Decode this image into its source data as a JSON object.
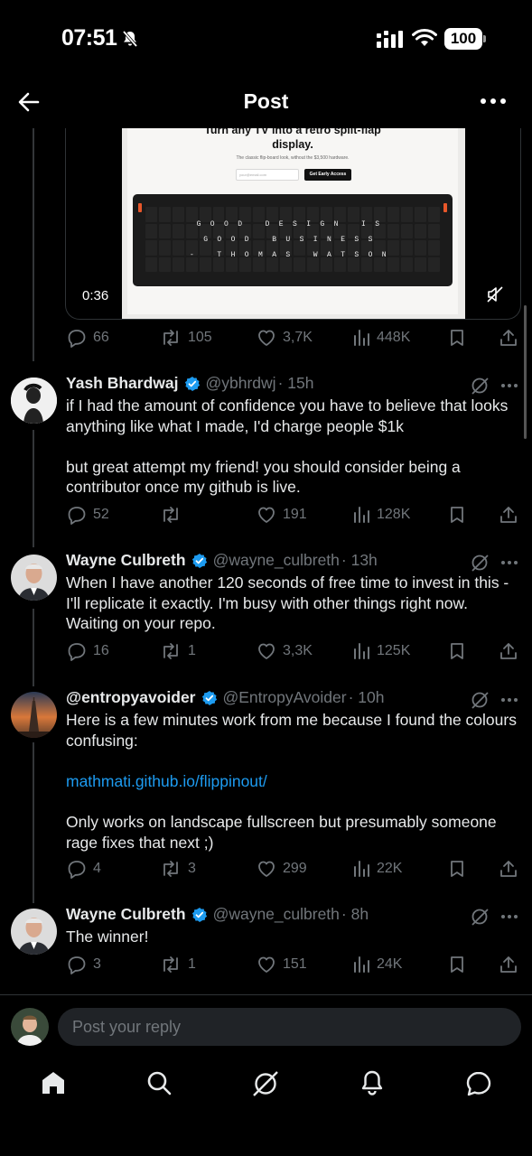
{
  "status_bar": {
    "time": "07:51",
    "battery": "100"
  },
  "header": {
    "title": "Post"
  },
  "video": {
    "headline_line1": "Turn any TV into a retro split-flap",
    "headline_line2": "display.",
    "subtitle": "The classic flip-board look, without the $3,500 hardware.",
    "input_placeholder": "your@email.com",
    "cta": "Get Early Access",
    "board_rows": [
      "GOOD DESIGN IS",
      "GOOD BUSINESS",
      "- THOMAS WATSON"
    ],
    "duration": "0:36"
  },
  "original_post_actions": {
    "replies": "66",
    "reposts": "105",
    "likes": "3,7K",
    "views": "448K"
  },
  "replies": [
    {
      "name": "Yash Bhardwaj",
      "handle": "@ybhrdwj",
      "time": "· 15h",
      "text": "if I had the amount of confidence you have to believe that looks anything like what I made, I'd charge people $1k\n\nbut great attempt my friend! you should consider being a contributor once my github is live.",
      "replies": "52",
      "reposts": "",
      "likes": "191",
      "views": "128K"
    },
    {
      "name": "Wayne Culbreth",
      "handle": "@wayne_culbreth",
      "time": "· 13h",
      "text": "When I have another 120 seconds of free time to invest in this - I'll replicate it exactly. I'm busy with other things right now. Waiting on your repo.",
      "replies": "16",
      "reposts": "1",
      "likes": "3,3K",
      "views": "125K"
    },
    {
      "name": "@entropyavoider",
      "handle": "@EntropyAvoider",
      "time": "· 10h",
      "text_part1": "Here is a few minutes work from me because I found the colours confusing:",
      "link": "mathmati.github.io/flippinout/",
      "text_part2": "Only works on landscape fullscreen but presumably someone rage fixes that next ;)",
      "replies": "4",
      "reposts": "3",
      "likes": "299",
      "views": "22K"
    },
    {
      "name": "Wayne Culbreth",
      "handle": "@wayne_culbreth",
      "time": "· 8h",
      "text": "The winner!",
      "replies": "3",
      "reposts": "1",
      "likes": "151",
      "views": "24K"
    }
  ],
  "reply_bar": {
    "placeholder": "Post your reply"
  },
  "nav": [
    "home-icon",
    "search-icon",
    "grok-icon",
    "notifications-icon",
    "messages-icon"
  ],
  "colors": {
    "background": "#000000",
    "text": "#e7e9ea",
    "muted": "#71767b",
    "link": "#1d9bf0",
    "verified": "#1d9bf0"
  }
}
